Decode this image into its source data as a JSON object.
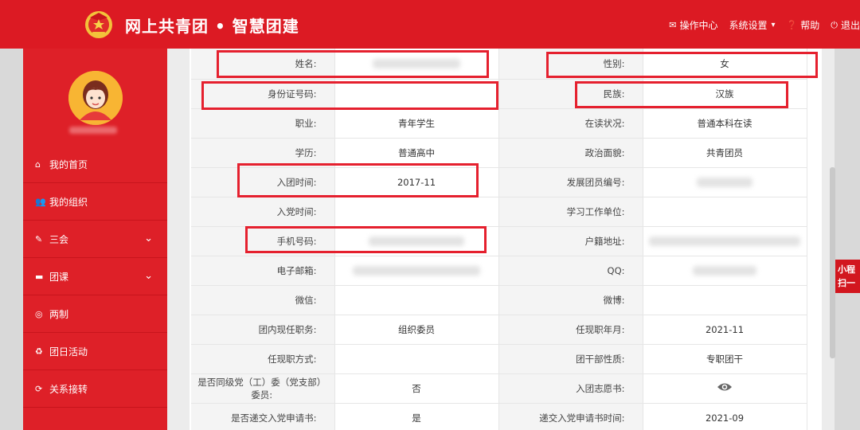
{
  "header": {
    "brand": "网上共青团 • 智慧团建",
    "actions": {
      "ops": "操作中心",
      "settings": "系统设置",
      "help": "帮助",
      "logout": "退出"
    }
  },
  "sidebar": {
    "items": [
      {
        "label": "我的首页",
        "icon": "home-icon"
      },
      {
        "label": "我的组织",
        "icon": "users-icon"
      },
      {
        "label": "三会",
        "icon": "edit-icon",
        "expandable": true
      },
      {
        "label": "团课",
        "icon": "folder-icon",
        "expandable": true
      },
      {
        "label": "两制",
        "icon": "circle-icon"
      },
      {
        "label": "团日活动",
        "icon": "recycle-icon"
      },
      {
        "label": "关系接转",
        "icon": "refresh-icon"
      }
    ]
  },
  "table": {
    "rows": [
      [
        {
          "label": "姓名:",
          "value": ""
        },
        {
          "label": "性别:",
          "value": "女"
        }
      ],
      [
        {
          "label": "身份证号码:",
          "value": ""
        },
        {
          "label": "民族:",
          "value": "汉族"
        }
      ],
      [
        {
          "label": "职业:",
          "value": "青年学生"
        },
        {
          "label": "在读状况:",
          "value": "普通本科在读"
        }
      ],
      [
        {
          "label": "学历:",
          "value": "普通高中"
        },
        {
          "label": "政治面貌:",
          "value": "共青团员"
        }
      ],
      [
        {
          "label": "入团时间:",
          "value": "2017-11"
        },
        {
          "label": "发展团员编号:",
          "value": ""
        }
      ],
      [
        {
          "label": "入党时间:",
          "value": ""
        },
        {
          "label": "学习工作单位:",
          "value": ""
        }
      ],
      [
        {
          "label": "手机号码:",
          "value": ""
        },
        {
          "label": "户籍地址:",
          "value": ""
        }
      ],
      [
        {
          "label": "电子邮箱:",
          "value": ""
        },
        {
          "label": "QQ:",
          "value": ""
        }
      ],
      [
        {
          "label": "微信:",
          "value": ""
        },
        {
          "label": "微博:",
          "value": ""
        }
      ],
      [
        {
          "label": "团内现任职务:",
          "value": "组织委员"
        },
        {
          "label": "任现职年月:",
          "value": "2021-11"
        }
      ],
      [
        {
          "label": "任现职方式:",
          "value": ""
        },
        {
          "label": "团干部性质:",
          "value": "专职团干"
        }
      ],
      [
        {
          "label": "是否同级党（工）委（党支部）委员:",
          "value": "否"
        },
        {
          "label": "入团志愿书:",
          "value": ""
        }
      ],
      [
        {
          "label": "是否递交入党申请书:",
          "value": "是"
        },
        {
          "label": "递交入党申请书时间:",
          "value": "2021-09"
        }
      ]
    ]
  },
  "float_tab": {
    "line1": "小程",
    "line2": "扫一"
  },
  "colors": {
    "brand_red": "#dc1a23",
    "sidebar_red": "#de2028",
    "highlight": "#e5202e"
  }
}
